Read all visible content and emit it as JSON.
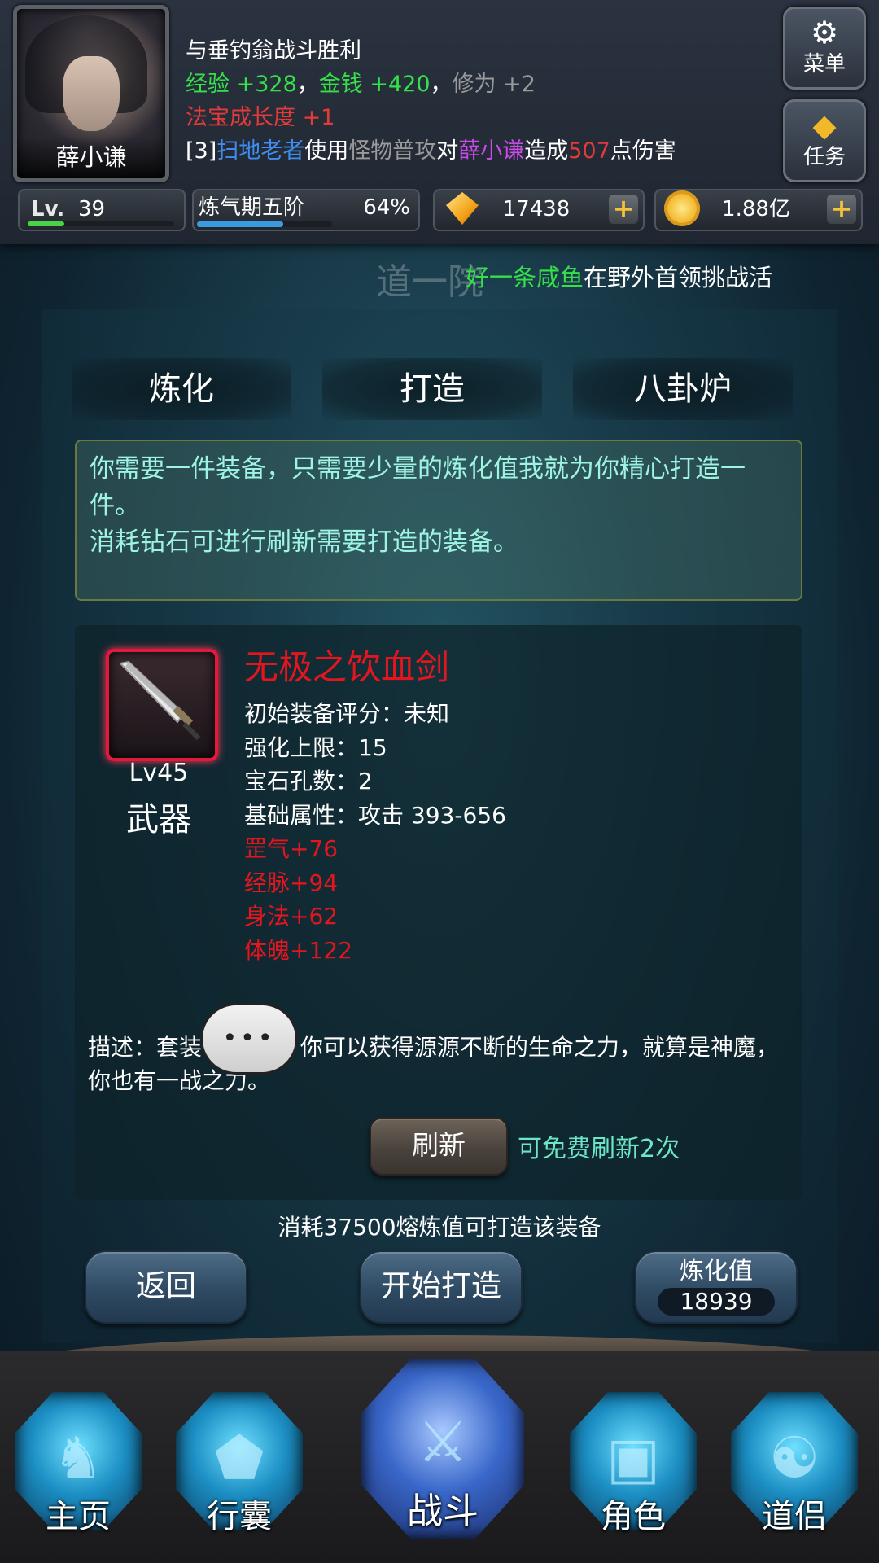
{
  "player": {
    "name": "薛小谦",
    "level_label": "Lv.",
    "level": "39",
    "level_progress": 0.25,
    "realm": "炼气期五阶",
    "realm_progress_text": "64%",
    "realm_progress": 0.64
  },
  "log": {
    "line1": "与垂钓翁战斗胜利",
    "line2": {
      "exp_label": "经验",
      "exp_value": "+328",
      "sep1": "，",
      "money_label": "金钱",
      "money_value": "+420",
      "sep2": "，",
      "cult_label": "修为",
      "cult_value": "+2"
    },
    "line3": {
      "label": "法宝成长度",
      "value": "+1"
    },
    "line4": {
      "prefix": "[3]",
      "attacker": "扫地老者",
      "t1": "使用",
      "skill": "怪物普攻",
      "t2": "对",
      "target": "薛小谦",
      "t3": "造成",
      "damage": "507",
      "t4": "点伤害"
    }
  },
  "side_buttons": {
    "menu_label": "菜单",
    "menu_icon": "gear-icon",
    "task_label": "任务",
    "task_icon": "diamond-icon"
  },
  "currency": {
    "gems": "17438",
    "gold": "1.88亿",
    "add": "+"
  },
  "broadcast": {
    "ghost_text": "道一院",
    "player": "好一条咸鱼",
    "message": "在野外首领挑战活"
  },
  "tabs": [
    "炼化",
    "打造",
    "八卦炉"
  ],
  "intro": {
    "line1": "你需要一件装备，只需要少量的炼化值我就为你精心打造一件。",
    "line2": "消耗钻石可进行刷新需要打造的装备。"
  },
  "item": {
    "level": "Lv45",
    "type": "武器",
    "name": "无极之饮血剑",
    "attrs": [
      "初始装备评分：未知",
      "强化上限：15",
      "宝石孔数：2",
      "基础属性：攻击 393-656"
    ],
    "bonus": [
      "罡气+76",
      "经脉+94",
      "身法+62",
      "体魄+122"
    ],
    "description": "描述：套装   穿上它，你可以获得源源不断的生命之力，就算是神魔，你也有一战之力。",
    "bubble": "•••"
  },
  "refresh": {
    "button": "刷新",
    "free_text": "可免费刷新2次"
  },
  "cost_text": "消耗37500熔炼值可打造该装备",
  "actions": {
    "back": "返回",
    "start": "开始打造",
    "refine_label": "炼化值",
    "refine_value": "18939"
  },
  "nav": [
    "主页",
    "行囊",
    "战斗",
    "角色",
    "道侣"
  ]
}
